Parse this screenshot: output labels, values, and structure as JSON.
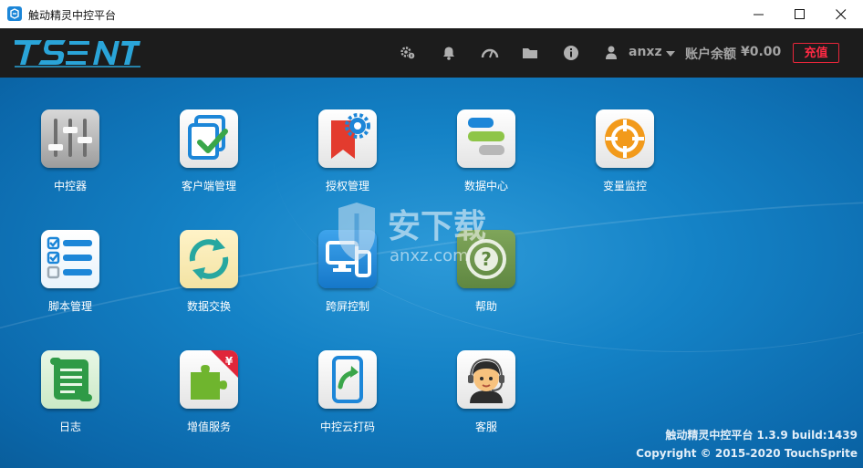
{
  "window": {
    "title": "触动精灵中控平台",
    "controls": [
      "minimize",
      "maximize",
      "close"
    ]
  },
  "header": {
    "logo_icon": "ts-ent-logo",
    "icons": [
      "settings-info-icon",
      "bell-icon",
      "speedometer-icon",
      "folder-icon",
      "info-icon",
      "user-icon"
    ],
    "username": "anxz",
    "balance_label": "账户余额",
    "balance_amount": "¥0.00",
    "recharge_label": "充值",
    "accent_color": "#e8263a"
  },
  "apps": [
    {
      "label": "中控器",
      "icon": "mixer-sliders-icon"
    },
    {
      "label": "客户端管理",
      "icon": "client-check-icon"
    },
    {
      "label": "授权管理",
      "icon": "bookmark-gear-icon"
    },
    {
      "label": "数据中心",
      "icon": "data-bars-icon"
    },
    {
      "label": "变量监控",
      "icon": "crosshair-icon"
    },
    {
      "label": "脚本管理",
      "icon": "checklist-icon"
    },
    {
      "label": "数据交换",
      "icon": "sync-arrows-icon"
    },
    {
      "label": "跨屏控制",
      "icon": "multi-screen-icon"
    },
    {
      "label": "帮助",
      "icon": "help-icon"
    },
    {
      "label": "日志",
      "icon": "scroll-icon"
    },
    {
      "label": "增值服务",
      "icon": "puzzle-yen-icon"
    },
    {
      "label": "中控云打码",
      "icon": "cloud-code-icon"
    },
    {
      "label": "客服",
      "icon": "headset-agent-icon"
    }
  ],
  "watermark": {
    "text": "安下载",
    "url_text": "anxz.com"
  },
  "footer": {
    "version": "触动精灵中控平台 1.3.9 build:1439",
    "copyright": "Copyright © 2015-2020 TouchSprite"
  },
  "colors": {
    "background_blue": "#1482c6",
    "header_dark": "#1c1c1c"
  }
}
